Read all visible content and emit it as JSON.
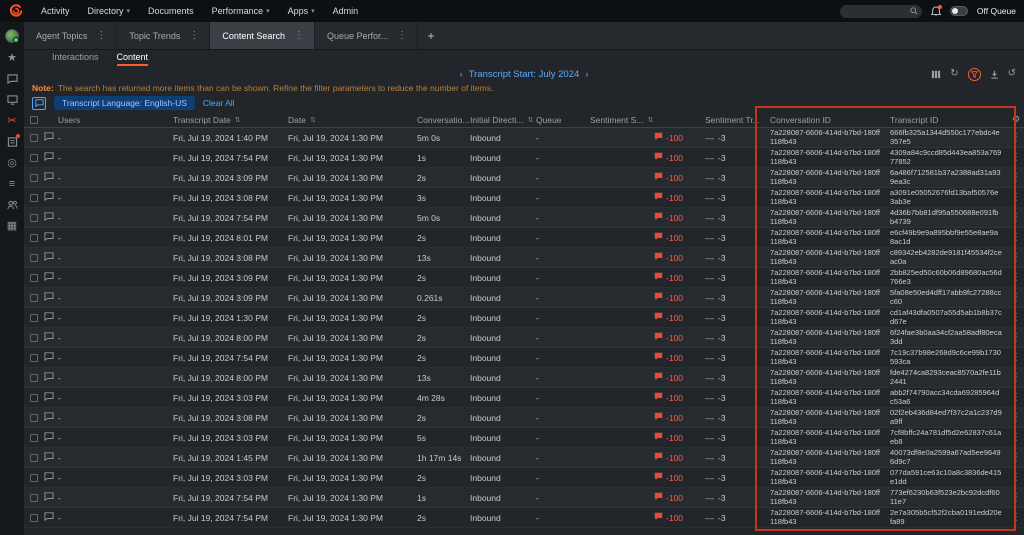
{
  "icons": {
    "caret": "▾",
    "kebab": "⋮",
    "plus": "+",
    "sort": "⇅",
    "gear": "⚙",
    "refresh": "↻",
    "history": "↺",
    "star": "★",
    "scissors": "✂",
    "target": "◎",
    "list": "≡",
    "apps": "▦",
    "prev": "‹",
    "next": "›",
    "dash": "—"
  },
  "topnav": {
    "items": [
      {
        "label": "Activity",
        "caret": false
      },
      {
        "label": "Directory",
        "caret": true
      },
      {
        "label": "Documents",
        "caret": false
      },
      {
        "label": "Performance",
        "caret": true
      },
      {
        "label": "Apps",
        "caret": true
      },
      {
        "label": "Admin",
        "caret": false
      }
    ],
    "search_placeholder": "",
    "off_queue_label": "Off Queue"
  },
  "workspace_tabs": {
    "tabs": [
      {
        "label": "Agent Topics",
        "active": false
      },
      {
        "label": "Topic Trends",
        "active": false
      },
      {
        "label": "Content Search",
        "active": true
      },
      {
        "label": "Queue Perfor...",
        "active": false
      }
    ],
    "add_label": "+"
  },
  "view_tabs": [
    {
      "label": "Interactions",
      "active": false
    },
    {
      "label": "Content",
      "active": true
    }
  ],
  "pagination": {
    "prev": "‹",
    "label": "Transcript Start: July 2024",
    "next": "›"
  },
  "note": {
    "label": "Note:",
    "text": "The search has returned more items than can be shown. Refine the filter parameters to reduce the number of items."
  },
  "filters": {
    "chip_label": "Transcript Language: English-US",
    "clear_label": "Clear All"
  },
  "table": {
    "columns": [
      {
        "label": "Users",
        "sortable": false
      },
      {
        "label": "Transcript Date",
        "sortable": true
      },
      {
        "label": "Date",
        "sortable": true
      },
      {
        "label": "Conversatio...",
        "sortable": true
      },
      {
        "label": "Initial Directi...",
        "sortable": true
      },
      {
        "label": "Queue",
        "sortable": false
      },
      {
        "label": "Sentiment S...",
        "sortable": true
      },
      {
        "label": "Sentiment Tr...",
        "sortable": false
      },
      {
        "label": "Conversation ID",
        "sortable": false
      },
      {
        "label": "Transcript ID",
        "sortable": false
      }
    ],
    "shared": {
      "users": "-",
      "date": "Fri, Jul 19, 2024 1:30 PM",
      "direction": "Inbound",
      "queue": "-",
      "sentiment_score": "-100",
      "sentiment_trend": "-3",
      "conversation_id": "7a228087-6606-414d-b7bd-180ff118fb43"
    },
    "rows": [
      {
        "transcript_date": "Fri, Jul 19, 2024 1:40 PM",
        "duration": "5m 0s",
        "transcript_id": "666fb325a1344d550c177ebdc4e357e5"
      },
      {
        "transcript_date": "Fri, Jul 19, 2024 7:54 PM",
        "duration": "1s",
        "transcript_id": "4309a84c9ccd85d443ea853a76977852"
      },
      {
        "transcript_date": "Fri, Jul 19, 2024 3:09 PM",
        "duration": "2s",
        "transcript_id": "6a486f712581b37a2388ad31a939ea3c"
      },
      {
        "transcript_date": "Fri, Jul 19, 2024 3:08 PM",
        "duration": "3s",
        "transcript_id": "a3091e05052676fd13baf50576e3ab3e"
      },
      {
        "transcript_date": "Fri, Jul 19, 2024 7:54 PM",
        "duration": "5m 0s",
        "transcript_id": "4d36b7bb81df95a550688e091fbb4739"
      },
      {
        "transcript_date": "Fri, Jul 19, 2024 8:01 PM",
        "duration": "2s",
        "transcript_id": "e6cf49b9e9a895bbf9e55e8ae9a8ac1d"
      },
      {
        "transcript_date": "Fri, Jul 19, 2024 3:08 PM",
        "duration": "13s",
        "transcript_id": "c89342eb4282de9181f45534f2ceac0a"
      },
      {
        "transcript_date": "Fri, Jul 19, 2024 3:09 PM",
        "duration": "2s",
        "transcript_id": "2bb825ed50c60b06d89680ac56d766e3"
      },
      {
        "transcript_date": "Fri, Jul 19, 2024 3:09 PM",
        "duration": "0.261s",
        "transcript_id": "5fa08e50ed4dff17abb9fc27288ccc60"
      },
      {
        "transcript_date": "Fri, Jul 19, 2024 1:30 PM",
        "duration": "2s",
        "transcript_id": "cd1af43dfa0507a55d5ab1b8b37cd67e"
      },
      {
        "transcript_date": "Fri, Jul 19, 2024 8:00 PM",
        "duration": "2s",
        "transcript_id": "6f24fae3b0aa34cf2aa58adf80eca3dd"
      },
      {
        "transcript_date": "Fri, Jul 19, 2024 7:54 PM",
        "duration": "2s",
        "transcript_id": "7c19c37b98e268d9c6ce99b1730593ca"
      },
      {
        "transcript_date": "Fri, Jul 19, 2024 8:00 PM",
        "duration": "13s",
        "transcript_id": "fde4274ca8293ceac8570a2fe11b2441"
      },
      {
        "transcript_date": "Fri, Jul 19, 2024 3:03 PM",
        "duration": "4m 28s",
        "transcript_id": "abb2f74790acc34cda69285964dc53a6"
      },
      {
        "transcript_date": "Fri, Jul 19, 2024 3:08 PM",
        "duration": "2s",
        "transcript_id": "02f2eb436d84ed7f37c2a1c237d9a9ff"
      },
      {
        "transcript_date": "Fri, Jul 19, 2024 3:03 PM",
        "duration": "5s",
        "transcript_id": "7cf8bffc24a781df5d2e62837c61aeb8"
      },
      {
        "transcript_date": "Fri, Jul 19, 2024 1:45 PM",
        "duration": "1h 17m 14s",
        "transcript_id": "40073df8e0a2599a67ad5ee96496d9c7"
      },
      {
        "transcript_date": "Fri, Jul 19, 2024 3:03 PM",
        "duration": "2s",
        "transcript_id": "077da591ce63c10a8c3836de415e1dd"
      },
      {
        "transcript_date": "Fri, Jul 19, 2024 7:54 PM",
        "duration": "1s",
        "transcript_id": "773ef6230b63f523e2bc92dcdf6011e7"
      },
      {
        "transcript_date": "Fri, Jul 19, 2024 7:54 PM",
        "duration": "2s",
        "transcript_id": "2e7a305b5cf52f2cba0191edd20efa89"
      }
    ]
  },
  "colors": {
    "accent_orange": "#ff4f1f",
    "negative_red": "#ff5c49",
    "link_blue": "#4da6ff",
    "annotation_red": "#c9341f"
  }
}
